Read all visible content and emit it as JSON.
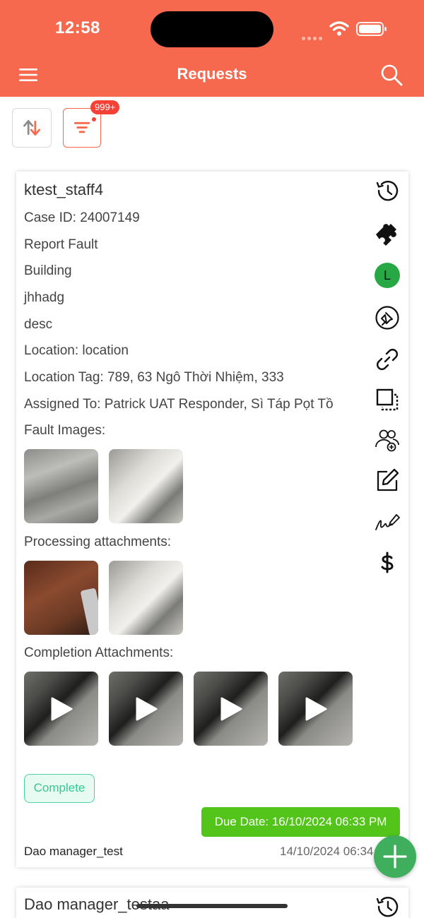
{
  "status_bar": {
    "time": "12:58"
  },
  "header": {
    "title": "Requests"
  },
  "toolbar": {
    "filter_badge": "999+"
  },
  "request": {
    "title": "ktest_staff4",
    "case_id": "Case ID: 24007149",
    "type": "Report Fault",
    "category": "Building",
    "subject": "jhhadg",
    "description": "desc",
    "location": "Location: location",
    "location_tag": "Location Tag: 789, 63 Ngô Thời Nhiệm, 333",
    "assigned_to": "Assigned To: Patrick UAT Responder, Sì Táp Pọt Tồ",
    "fault_images_label": "Fault Images:",
    "processing_label": "Processing attachments:",
    "completion_label": "Completion Attachments:",
    "status": "Complete",
    "due_date": "Due Date: 16/10/2024 06:33 PM",
    "author": "Dao manager_test",
    "created": "14/10/2024 06:34",
    "avatar_letter": "L",
    "action_icons": [
      "history-icon",
      "puzzle-icon",
      "avatar",
      "pin-icon",
      "link-icon",
      "copy-icon",
      "group-add-icon",
      "edit-icon",
      "signature-icon",
      "dollar-icon"
    ]
  },
  "next_request": {
    "title": "Dao manager_testaa"
  },
  "colors": {
    "header": "#f7694f",
    "badge": "#f44336",
    "due": "#52c41a",
    "fab": "#3fae5d",
    "status": "#38c793"
  }
}
